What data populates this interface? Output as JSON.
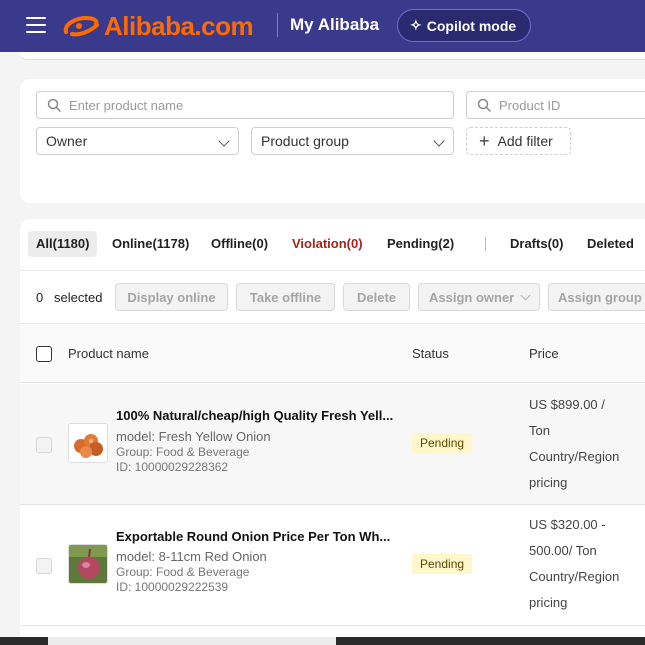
{
  "header": {
    "logo_text": "Alibaba.com",
    "section_title": "My Alibaba",
    "copilot_label": "Copilot mode",
    "brand_color": "#ff6a00",
    "bar_color": "#3a3a8c"
  },
  "filters": {
    "product_name_placeholder": "Enter product name",
    "product_id_placeholder": "Product ID",
    "owner_select": "Owner",
    "group_select": "Product group",
    "add_filter_label": "Add filter"
  },
  "tabs": [
    {
      "label": "All(1180)"
    },
    {
      "label": "Online(1178)"
    },
    {
      "label": "Offline(0)"
    },
    {
      "label": "Violation(0)"
    },
    {
      "label": "Pending(2)"
    },
    {
      "label": "Drafts(0)"
    },
    {
      "label": "Deleted"
    }
  ],
  "actions": {
    "selected_count": "0",
    "selected_word": "selected",
    "display_online": "Display online",
    "take_offline": "Take offline",
    "delete": "Delete",
    "assign_owner": "Assign owner",
    "assign_group": "Assign group"
  },
  "table": {
    "columns": {
      "product_name": "Product name",
      "status": "Status",
      "price": "Price"
    },
    "rows": [
      {
        "title": "100% Natural/cheap/high Quality Fresh Yell...",
        "model": "model: Fresh Yellow Onion",
        "group": "Group: Food & Beverage",
        "id": "ID: 10000029228362",
        "status": "Pending",
        "price_1": "US $899.00 /",
        "price_2": "Ton",
        "price_3": "Country/Region",
        "price_4": "pricing",
        "thumb_icon": "onion-product-image"
      },
      {
        "title": "Exportable Round Onion Price Per Ton Wh...",
        "model": "model: 8-11cm Red Onion",
        "group": "Group: Food & Beverage",
        "id": "ID: 10000029222539",
        "status": "Pending",
        "price_1": "US $320.00 -",
        "price_2": "500.00/ Ton",
        "price_3": "Country/Region",
        "price_4": "pricing",
        "thumb_icon": "red-onion-product-image"
      }
    ]
  }
}
